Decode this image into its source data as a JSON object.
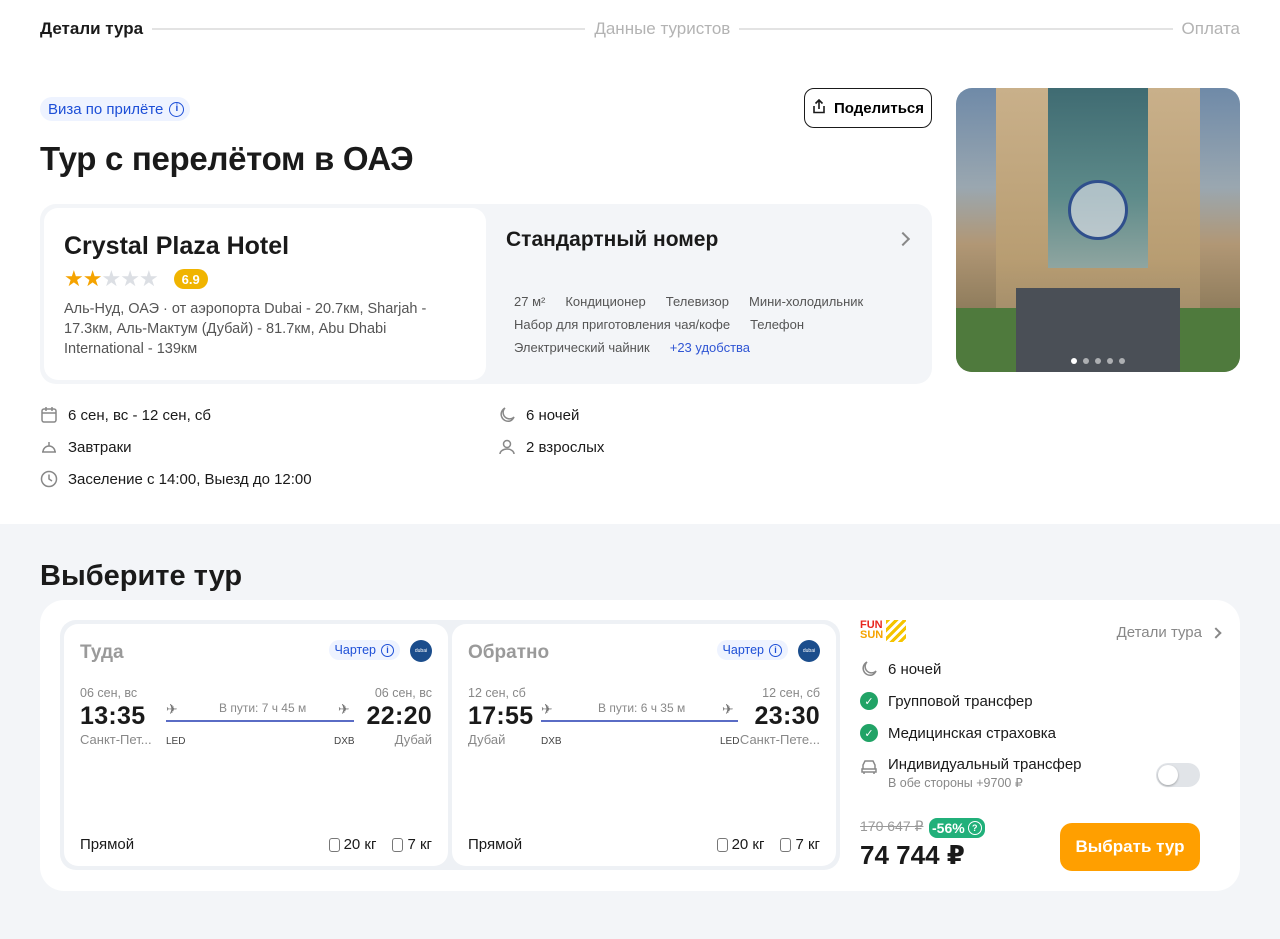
{
  "stepper": {
    "steps": [
      "Детали тура",
      "Данные туристов",
      "Оплата"
    ]
  },
  "visa": {
    "label": "Виза по прилёте"
  },
  "share": {
    "label": "Поделиться"
  },
  "page": {
    "title": "Тур с перелётом в ОАЭ"
  },
  "hotel": {
    "name": "Crystal Plaza Hotel",
    "stars": 2,
    "stars_max": 5,
    "rating": "6.9",
    "address": "Аль-Нуд, ОАЭ · от аэропорта Dubai - 20.7км, Sharjah - 17.3км, Аль-Мактум (Дубай) - 81.7км, Abu Dhabi International - 139км"
  },
  "room": {
    "title": "Стандартный номер",
    "amenities": [
      "27 м²",
      "Кондиционер",
      "Телевизор",
      "Мини-холодильник",
      "Набор для приготовления чая/кофе",
      "Телефон",
      "Электрический чайник"
    ],
    "more": "+23 удобства"
  },
  "tour": {
    "dates": "6 сен, вс - 12 сен, сб",
    "nights": "6 ночей",
    "meals": "Завтраки",
    "guests": "2 взрослых",
    "checkin": "Заселение с 14:00, Выезд до 12:00"
  },
  "choose": {
    "title": "Выберите тур"
  },
  "flights": [
    {
      "direction": "Туда",
      "charter": "Чартер",
      "dep_date": "06 сен, вс",
      "dep_time": "13:35",
      "dep_city": "Санкт-Пет...",
      "dep_code": "LED",
      "duration": "В пути: 7 ч 45 м",
      "arr_date": "06 сен, вс",
      "arr_time": "22:20",
      "arr_city": "Дубай",
      "arr_code": "DXB",
      "type": "Прямой",
      "bag": "20 кг",
      "hand": "7 кг"
    },
    {
      "direction": "Обратно",
      "charter": "Чартер",
      "dep_date": "12 сен, сб",
      "dep_time": "17:55",
      "dep_city": "Дубай",
      "dep_code": "DXB",
      "duration": "В пути: 6 ч 35 м",
      "arr_date": "12 сен, сб",
      "arr_time": "23:30",
      "arr_city": "Санкт-Пете...",
      "arr_code": "LED",
      "type": "Прямой",
      "bag": "20 кг",
      "hand": "7 кг"
    }
  ],
  "summary": {
    "brand_top": "FUN",
    "brand_bottom": "SUN",
    "details_link": "Детали тура",
    "nights": "6 ночей",
    "group_transfer": "Групповой трансфер",
    "insurance": "Медицинская страховка",
    "ind_transfer": "Индивидуальный трансфер",
    "ind_transfer_sub": "В обе стороны +9700 ₽",
    "ind_transfer_enabled": false,
    "old_price": "170 647 ₽",
    "discount": "-56%",
    "price": "74 744 ₽",
    "cta": "Выбрать тур"
  },
  "colors": {
    "accent_orange": "#ff9f00",
    "link_blue": "#1d4fd7",
    "success_green": "#21a366",
    "rating_yellow": "#f0b400"
  }
}
